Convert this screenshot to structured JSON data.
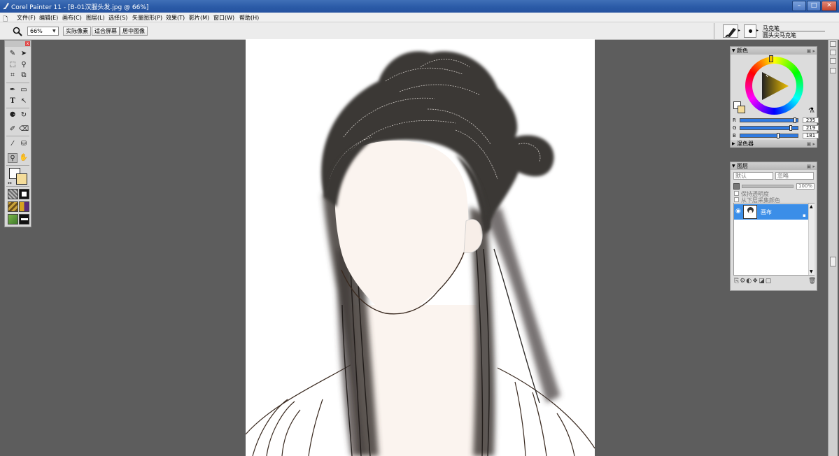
{
  "window": {
    "title": "Corel Painter 11 - [B-01汉服头发.jpg @ 66%]",
    "minimize": "–",
    "maximize": "□",
    "close": "✕"
  },
  "menu": [
    "文件(F)",
    "编辑(E)",
    "画布(C)",
    "图层(L)",
    "选择(S)",
    "矢量图形(P)",
    "效果(T)",
    "影片(M)",
    "窗口(W)",
    "帮助(H)"
  ],
  "propbar": {
    "zoom_value": "66%",
    "actual_pixels": "实际像素",
    "fit_screen": "适合屏幕",
    "center_image": "居中图像"
  },
  "brush": {
    "category": "马克笔",
    "variant": "圆头尖马克笔"
  },
  "colors_panel": {
    "title": "颜色",
    "r_label": "R",
    "r_value": "235",
    "g_label": "G",
    "g_value": "219",
    "b_label": "B",
    "b_value": "181",
    "primary_color": "#2a2a2a",
    "secondary_color": "#ebdbb5"
  },
  "mixer_panel": {
    "title": "混色器"
  },
  "layers_panel": {
    "title": "图层",
    "composite_method": "默认",
    "composite_depth": "忽略",
    "opacity_value": "100%",
    "preserve_transparency": "保持透明度",
    "pick_up_color": "从下层采集颜色",
    "layer_name": "画布"
  }
}
